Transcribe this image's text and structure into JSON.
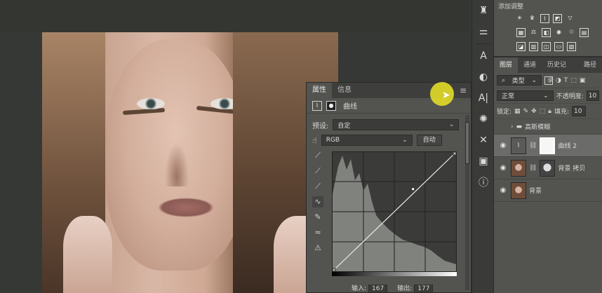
{
  "adjustments": {
    "title": "添加调整",
    "row1_icons": [
      "brightness-icon",
      "levels-icon",
      "curves-icon",
      "exposure-icon"
    ],
    "row2_icons": [
      "vibrance-icon",
      "hue-saturation-icon",
      "color-balance-icon",
      "black-white-icon",
      "photo-filter-icon",
      "channel-mixer-icon",
      "color-lookup-icon"
    ],
    "row3_icons": [
      "invert-icon",
      "posterize-icon",
      "threshold-icon",
      "gradient-map-icon",
      "selective-color-icon"
    ]
  },
  "layers_panel": {
    "tabs": [
      "图层",
      "通道",
      "历史记录",
      "路径"
    ],
    "filter_label": "类型",
    "blend_mode": "正常",
    "opacity_label": "不透明度:",
    "opacity_value": "10",
    "lock_label": "锁定:",
    "fill_label": "填充:",
    "fill_value": "10",
    "layers": [
      {
        "name": "高斯模糊",
        "type": "group",
        "visible": false
      },
      {
        "name": "曲线 2",
        "type": "adjustment",
        "visible": true,
        "selected": true
      },
      {
        "name": "背景 拷贝",
        "type": "image-with-mask",
        "visible": true
      },
      {
        "name": "背景",
        "type": "image",
        "visible": true
      }
    ]
  },
  "properties_panel": {
    "tabs": [
      "属性",
      "信息"
    ],
    "header_label": "曲线",
    "preset_label": "预设:",
    "preset_value": "自定",
    "channel_value": "RGB",
    "auto_button": "自动",
    "input_label": "输入:",
    "input_value": "167",
    "output_label": "输出:",
    "output_value": "177"
  },
  "curve": {
    "points": [
      [
        0,
        0
      ],
      [
        167,
        177
      ],
      [
        255,
        255
      ]
    ]
  },
  "colors": {
    "panel_bg": "#535450",
    "highlight_cursor": "#e2dc28"
  }
}
